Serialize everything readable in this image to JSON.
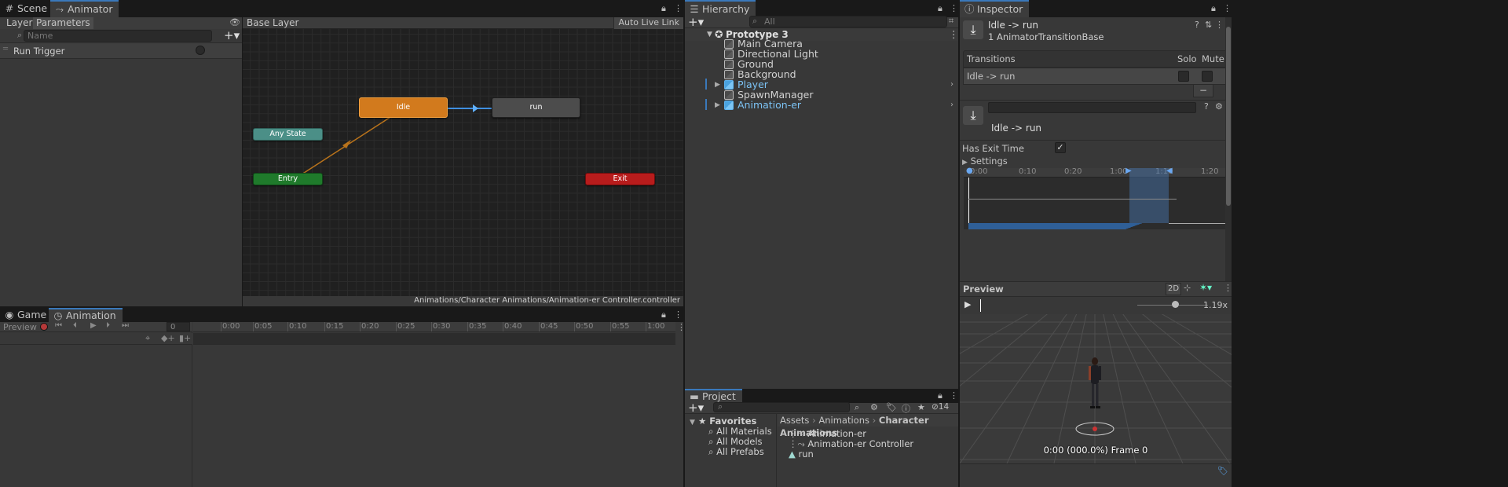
{
  "animator_window": {
    "tabs": [
      {
        "label": "Scene",
        "icon": "grid-icon"
      },
      {
        "label": "Animator",
        "icon": "animator-icon"
      }
    ],
    "left_tabs": [
      "Layers",
      "Parameters"
    ],
    "param_search_placeholder": "Name",
    "parameters": [
      {
        "name": "Run Trigger",
        "type": "trigger"
      }
    ],
    "breadcrumb": "Base Layer",
    "auto_live_link": "Auto Live Link",
    "states": {
      "idle": "Idle",
      "run": "run",
      "any_state": "Any State",
      "entry": "Entry",
      "exit": "Exit"
    },
    "controller_path": "Animations/Character Animations/Animation-er Controller.controller"
  },
  "animation_window": {
    "tabs": [
      {
        "label": "Game",
        "icon": "gamepad-icon"
      },
      {
        "label": "Animation",
        "icon": "clock-icon"
      }
    ],
    "preview_label": "Preview",
    "frame_value": "0",
    "ruler": [
      "0:00",
      "0:05",
      "0:10",
      "0:15",
      "0:20",
      "0:25",
      "0:30",
      "0:35",
      "0:40",
      "0:45",
      "0:50",
      "0:55",
      "1:00"
    ]
  },
  "hierarchy": {
    "title": "Hierarchy",
    "search_placeholder": "All",
    "scene": "Prototype 3",
    "items": [
      {
        "label": "Main Camera",
        "prefab": false,
        "expandable": false
      },
      {
        "label": "Directional Light",
        "prefab": false,
        "expandable": false
      },
      {
        "label": "Ground",
        "prefab": false,
        "expandable": false
      },
      {
        "label": "Background",
        "prefab": false,
        "expandable": false
      },
      {
        "label": "Player",
        "prefab": true,
        "expandable": true
      },
      {
        "label": "SpawnManager",
        "prefab": false,
        "expandable": false
      },
      {
        "label": "Animation-er",
        "prefab": true,
        "expandable": true
      }
    ]
  },
  "project": {
    "title": "Project",
    "hidden_count": "14",
    "favorites_label": "Favorites",
    "favorites": [
      "All Materials",
      "All Models",
      "All Prefabs"
    ],
    "breadcrumb": [
      "Assets",
      "Animations",
      "Character Animations"
    ],
    "assets": [
      {
        "label": "Animation-er",
        "icon": "animator-controller-icon"
      },
      {
        "label": "Animation-er Controller",
        "icon": "animator-controller-icon"
      },
      {
        "label": "run",
        "icon": "animation-clip-icon"
      }
    ]
  },
  "inspector": {
    "title": "Inspector",
    "object_name": "Idle -> run",
    "object_type": "1 AnimatorTransitionBase",
    "transitions_header": "Transitions",
    "solo_label": "Solo",
    "mute_label": "Mute",
    "transition_row": "Idle -> run",
    "minus": "−",
    "transition_title": "Idle -> run",
    "has_exit_time_label": "Has Exit Time",
    "has_exit_time": true,
    "settings_label": "Settings",
    "timeline_ticks": [
      "0:00",
      "0:10",
      "0:20",
      "1:00",
      "1:10",
      "1:20"
    ],
    "preview_label": "Preview",
    "mode_2d": "2D",
    "zoom": "1.19x",
    "preview_status": "0:00 (000.0%) Frame 0"
  }
}
